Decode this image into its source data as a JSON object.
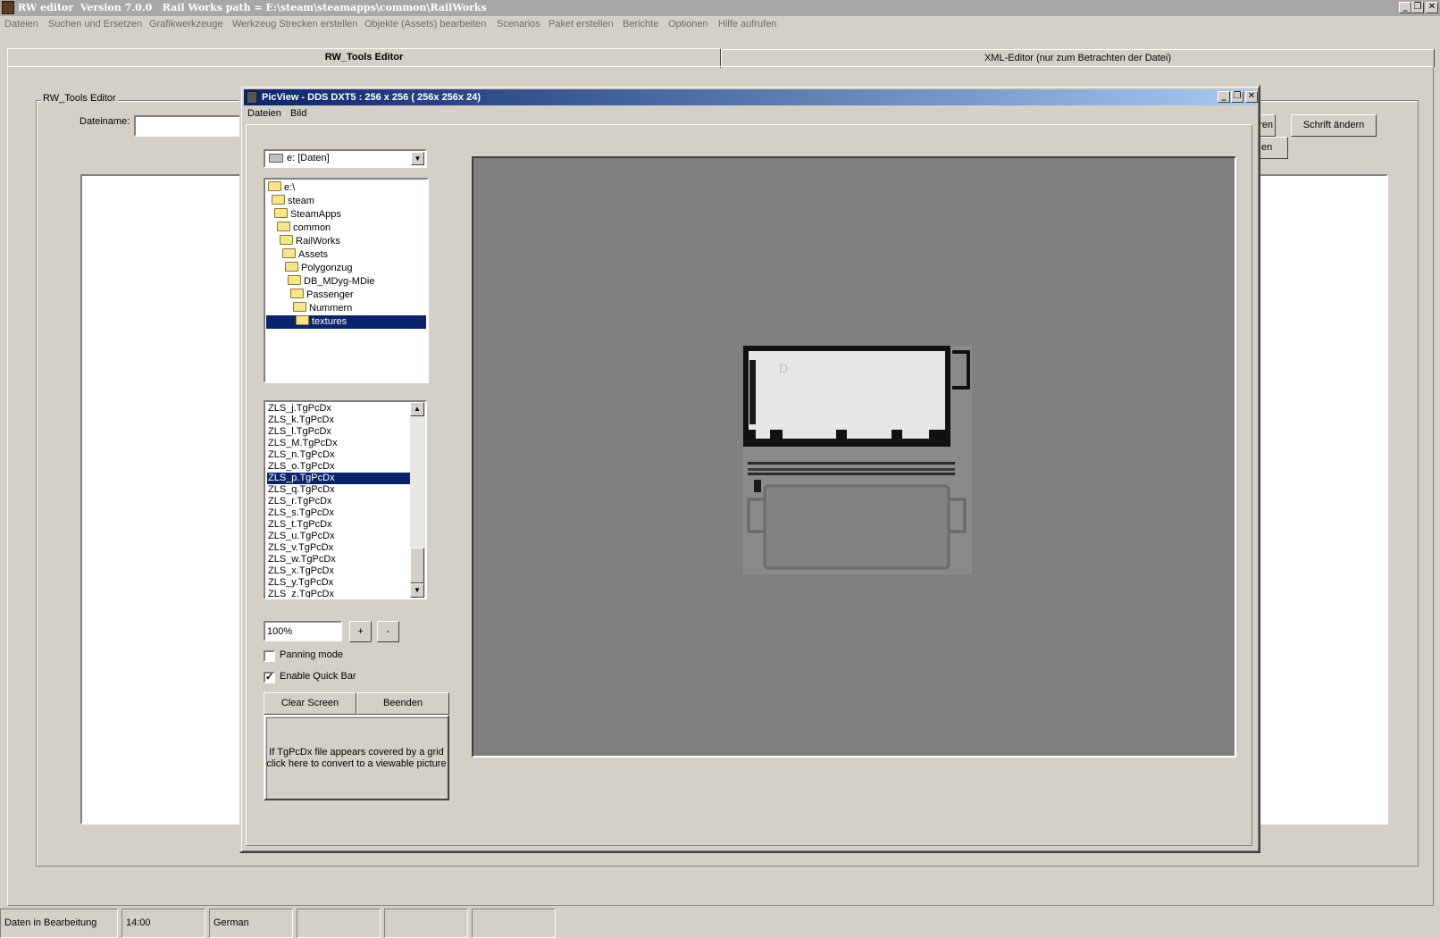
{
  "window": {
    "title": "RW editor  Version 7.0.0   Rail Works path = E:\\steam\\steamapps\\common\\RailWorks",
    "minimize": "_",
    "restore": "❐",
    "close": "✕"
  },
  "menubar": [
    "Dateien",
    "Suchen und Ersetzen",
    "Grafikwerkzeuge",
    "Werkzeug Strecken erstellen",
    "Objekte (Assets) bearbeiten",
    "Scenarios",
    "Paket erstellen",
    "Berichte",
    "Optionen",
    "Hilfe aufrufen"
  ],
  "tabs": {
    "active": "RW_Tools Editor",
    "inactive": "XML-Editor (nur zum Betrachten der Datei)"
  },
  "editor": {
    "group_label": "RW_Tools Editor",
    "filename_label": "Dateiname:",
    "filename_value": "",
    "btn_partial_1": "ren",
    "btn_partial_2": "en",
    "btn_font": "Schrift ändern"
  },
  "picview": {
    "title": "PicView - DDS DXT5 : 256 x 256 ( 256x 256x 24)",
    "menu": [
      "Dateien",
      "Bild"
    ],
    "drive": "e: [Daten]",
    "tree": [
      "e:\\",
      "steam",
      "SteamApps",
      "common",
      "RailWorks",
      "Assets",
      "Polygonzug",
      "DB_MDyg-MDie",
      "Passenger",
      "Nummern",
      "textures"
    ],
    "tree_selected_index": 10,
    "files": [
      "ZLS_j.TgPcDx",
      "ZLS_k.TgPcDx",
      "ZLS_l.TgPcDx",
      "ZLS_M.TgPcDx",
      "ZLS_n.TgPcDx",
      "ZLS_o.TgPcDx",
      "ZLS_p.TgPcDx",
      "ZLS_q.TgPcDx",
      "ZLS_r.TgPcDx",
      "ZLS_s.TgPcDx",
      "ZLS_t.TgPcDx",
      "ZLS_u.TgPcDx",
      "ZLS_v.TgPcDx",
      "ZLS_w.TgPcDx",
      "ZLS_x.TgPcDx",
      "ZLS_y.TgPcDx",
      "ZLS_z.TgPcDx"
    ],
    "files_selected_index": 6,
    "zoom": "100%",
    "zoom_in": "+",
    "zoom_out": "-",
    "panning_mode": "Panning mode",
    "panning_checked": false,
    "quick_bar": "Enable Quick Bar",
    "quick_bar_checked": true,
    "clear_screen": "Clear Screen",
    "exit": "Beenden",
    "convert_line1": "If TgPcDx file appears covered by a grid",
    "convert_line2": "click here to convert to a viewable picture",
    "texture_text": "D"
  },
  "statusbar": [
    "Daten in Bearbeitung",
    "14:00",
    "German",
    "",
    "",
    ""
  ]
}
